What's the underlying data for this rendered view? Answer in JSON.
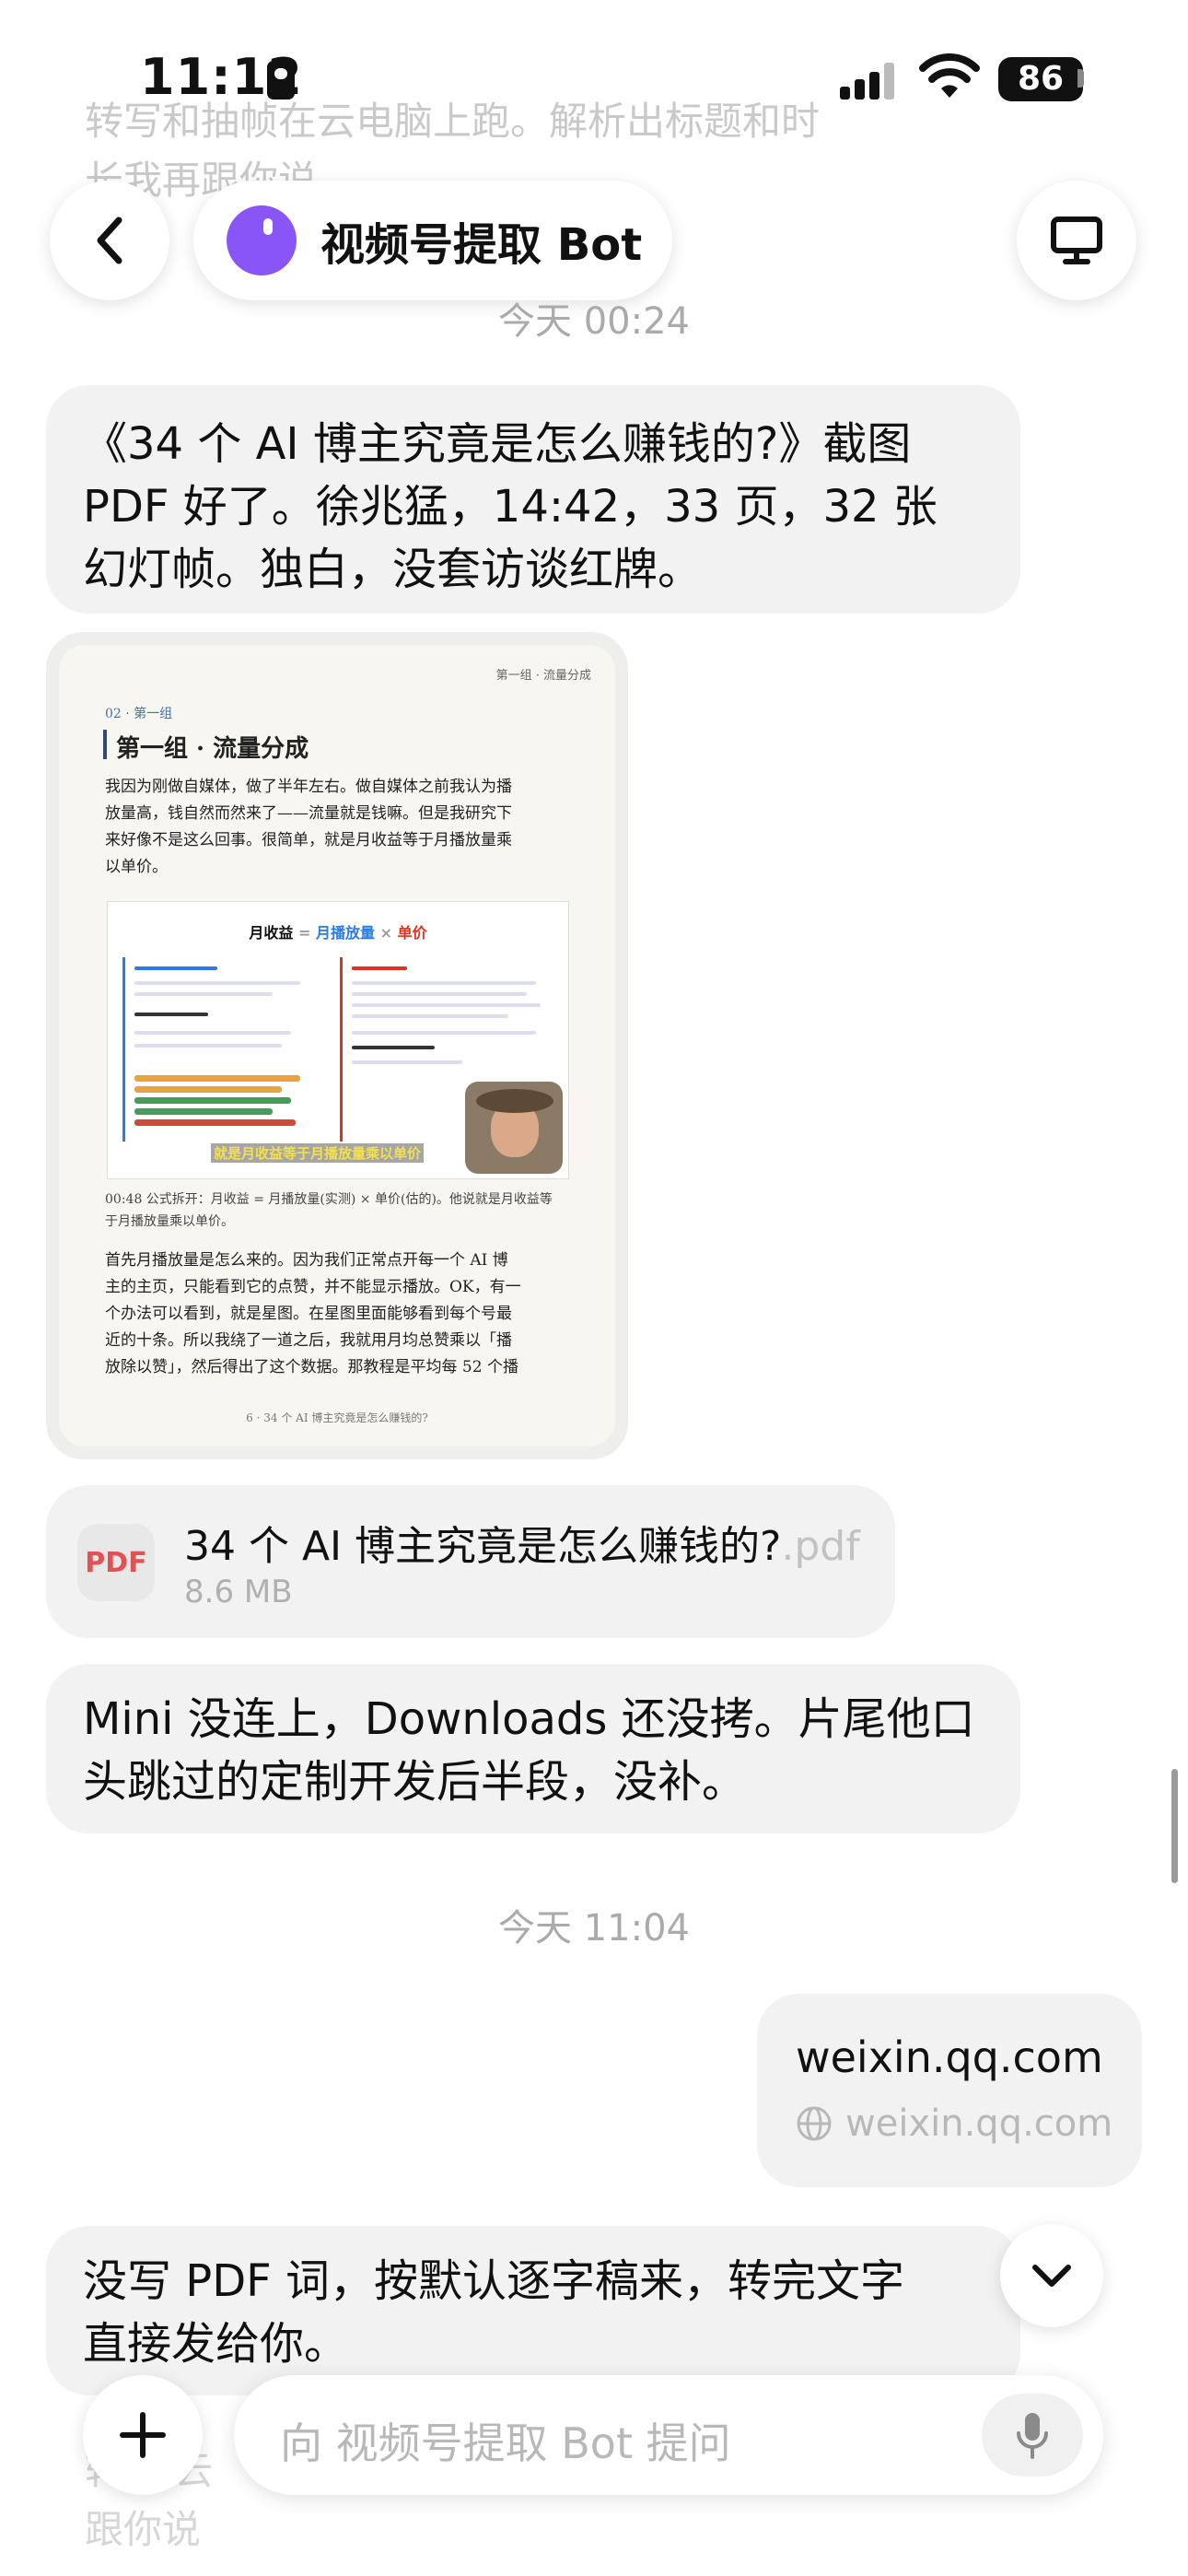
{
  "status_bar": {
    "time": "11:12",
    "battery": "86"
  },
  "ghost_top": {
    "line1": "转写和抽帧在云电脑上跑。解析出标题和时",
    "line2": "长我再跟你说"
  },
  "header": {
    "title": "视频号提取 Bot"
  },
  "timestamps": {
    "t1": "今天 00:24",
    "t2": "今天 11:04"
  },
  "messages": {
    "m1": {
      "line1": "《34 个 AI 博主究竟是怎么赚钱的?》截图",
      "line2": "PDF 好了。徐兆猛，14:42，33 页，32 张",
      "line3": "幻灯帧。独白，没套访谈红牌。"
    },
    "m2": {
      "line1": "Mini 没连上，Downloads 还没拷。片尾他口",
      "line2": "头跳过的定制开发后半段，没补。"
    },
    "m3": {
      "line1": "没写 PDF 词，按默认逐字稿来，转完文字",
      "line2": "直接发给你。"
    }
  },
  "preview_doc": {
    "header_right": "第一组 · 流量分成",
    "group_small": "02 · 第一组",
    "title": "第一组 · 流量分成",
    "para1": [
      "我因为刚做自媒体，做了半年左右。做自媒体之前我认为播",
      "放量高，钱自然而然来了——流量就是钱嘛。但是我研究下",
      "来好像不是这么回事。很简单，就是月收益等于月播放量乘",
      "以单价。"
    ],
    "slide": {
      "w1": "月收益",
      "eq": "=",
      "w2": "月播放量",
      "x": "×",
      "w3": "单价",
      "caption": "就是月收益等于月播放量乘以单价"
    },
    "timestamp_note": [
      "00:48 公式拆开：月收益 = 月播放量(实测) × 单价(估的)。他说就是月收益等",
      "于月播放量乘以单价。"
    ],
    "para2": [
      "首先月播放量是怎么来的。因为我们正常点开每一个 AI 博",
      "主的主页，只能看到它的点赞，并不能显示播放。OK，有一",
      "个办法可以看到，就是星图。在星图里面能够看到每个号最",
      "近的十条。所以我绕了一道之后，我就用月均总赞乘以「播",
      "放除以赞」，然后得出了这个数据。那教程是平均每 52 个播"
    ],
    "footer": "6 · 34 个 AI 博主究竟是怎么赚钱的?"
  },
  "file": {
    "icon_label": "PDF",
    "name": "34 个 AI 博主究竟是怎么赚钱的?",
    "ext": ".pdf",
    "size": "8.6 MB"
  },
  "link": {
    "title": "weixin.qq.com",
    "domain": "weixin.qq.com"
  },
  "composer": {
    "placeholder": "向 视频号提取 Bot 提问"
  },
  "ghost_bottom": {
    "line1": "转   在云",
    "line2": "跟你说"
  }
}
